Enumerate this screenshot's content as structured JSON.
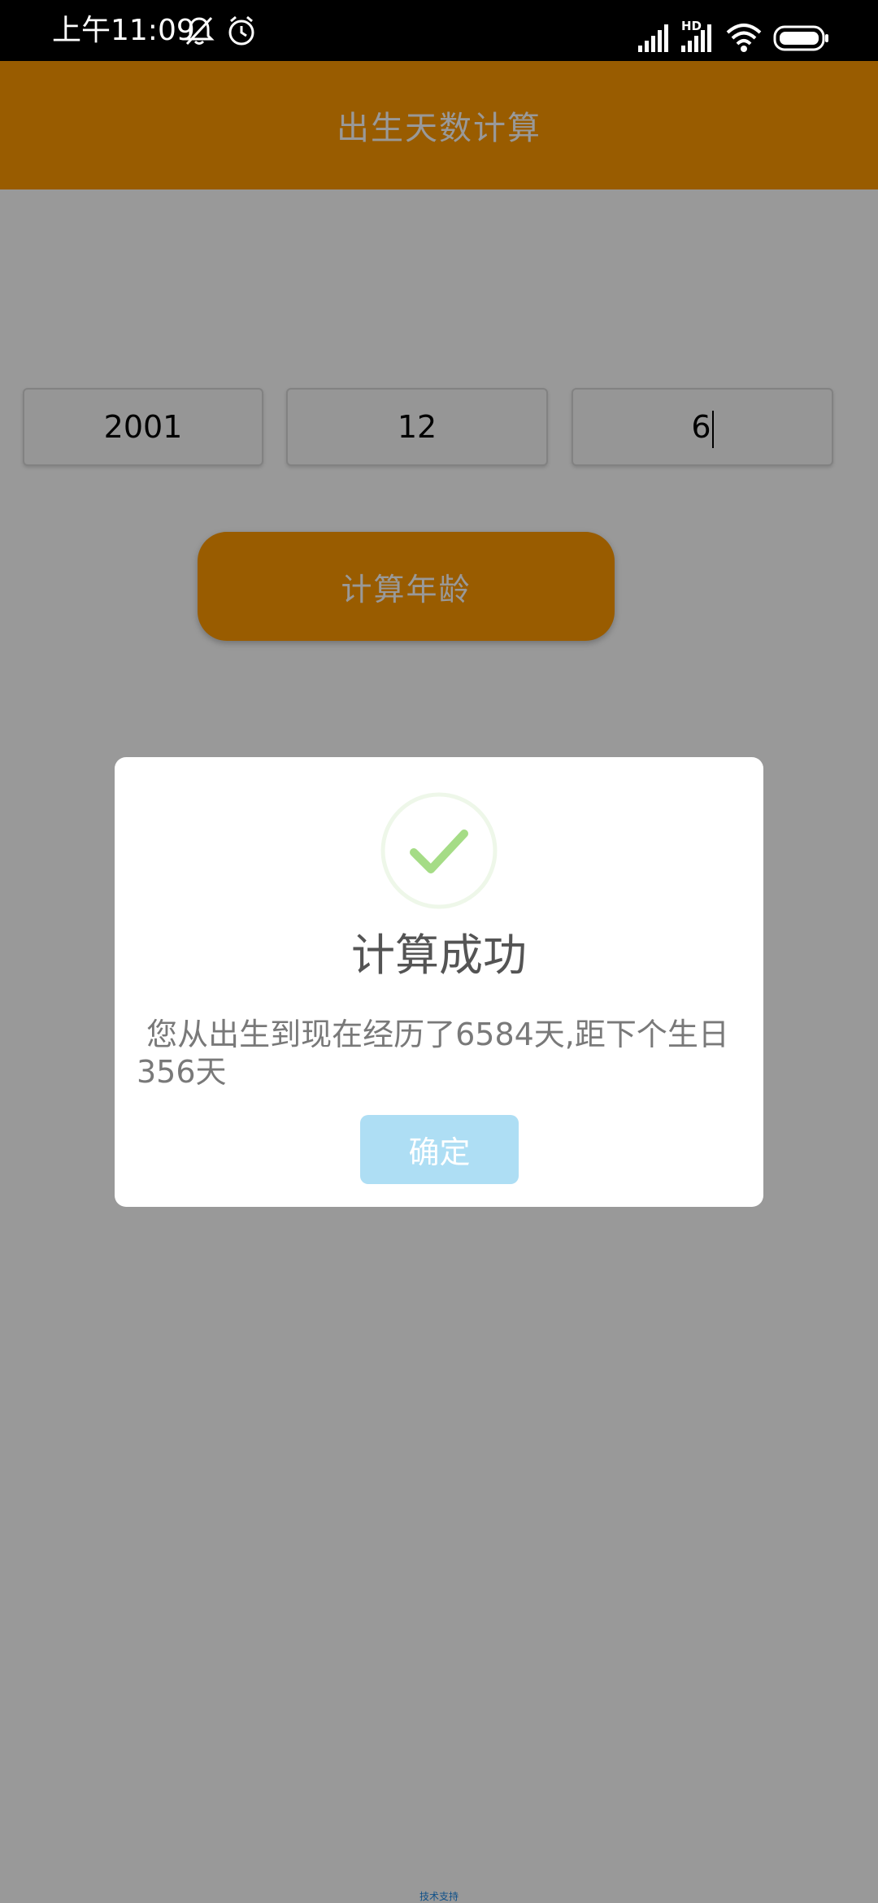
{
  "status_bar": {
    "time": "上午11:09",
    "icons": [
      "bell-muted-icon",
      "alarm-icon",
      "signal-icon",
      "signal-hd-icon",
      "wifi-icon",
      "battery-icon"
    ],
    "hd_label": "HD"
  },
  "header": {
    "title": "出生天数计算",
    "color": "#FF9900"
  },
  "form": {
    "year_value": "2001",
    "month_value": "12",
    "day_value": "6",
    "calc_button_label": "计算年龄"
  },
  "dialog": {
    "icon": "success-check-icon",
    "title": "计算成功",
    "message": " 您从出生到现在经历了6584天,距下个生日356天",
    "confirm_label": "确定",
    "confirm_color": "#AEDEF4",
    "check_color": "#A5DC86"
  },
  "footer": {
    "link_text": "技术支持"
  }
}
